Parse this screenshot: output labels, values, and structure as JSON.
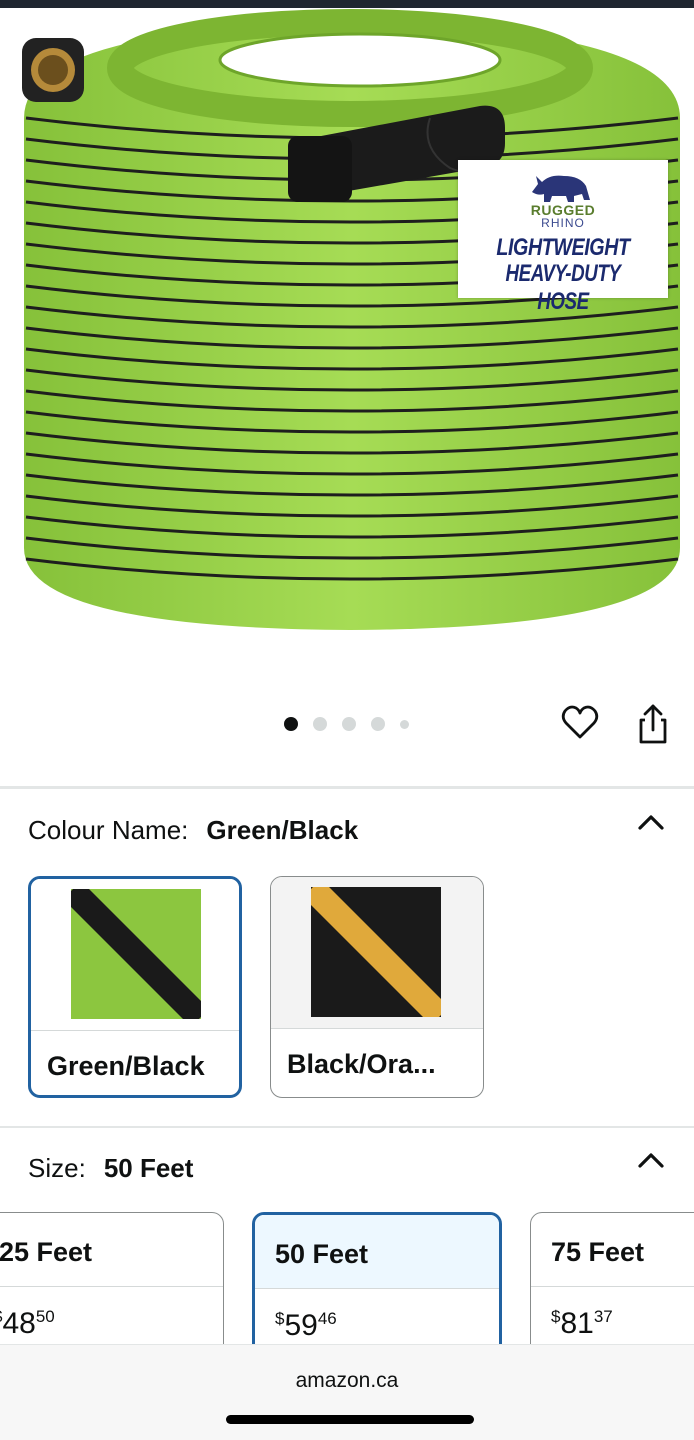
{
  "product_image": {
    "brand_line1": "RUGGED",
    "brand_line2": "RHINO",
    "tag_line1": "LIGHTWEIGHT",
    "tag_line2": "HEAVY-DUTY HOSE",
    "hose_color": "#9bd443",
    "stripe_color": "#1a1a1a"
  },
  "carousel": {
    "total_dots": 5,
    "active_index": 0
  },
  "actions": {
    "wishlist_icon": "heart-icon",
    "share_icon": "share-icon"
  },
  "colour_section": {
    "label": "Colour Name:",
    "selected_value": "Green/Black",
    "collapse_icon": "chevron-up-icon",
    "options": [
      {
        "label": "Green/Black",
        "base_color": "#8cc63f",
        "stripe_color": "#1a1a1a",
        "selected": true
      },
      {
        "label": "Black/Ora...",
        "base_color": "#1a1a1a",
        "stripe_color": "#e0a93b",
        "selected": false
      }
    ]
  },
  "size_section": {
    "label": "Size:",
    "selected_value": "50 Feet",
    "collapse_icon": "chevron-up-icon",
    "options": [
      {
        "label": "25 Feet",
        "currency": "$",
        "dollars": "48",
        "cents": "50",
        "selected": false
      },
      {
        "label": "50 Feet",
        "currency": "$",
        "dollars": "59",
        "cents": "46",
        "selected": true
      },
      {
        "label": "75 Feet",
        "currency": "$",
        "dollars": "81",
        "cents": "37",
        "selected": false
      }
    ]
  },
  "browser_bar": {
    "url": "amazon.ca"
  },
  "colors": {
    "selected_border": "#2162a1",
    "selected_fill": "#edf8ff",
    "divider": "#e3e6e6"
  }
}
